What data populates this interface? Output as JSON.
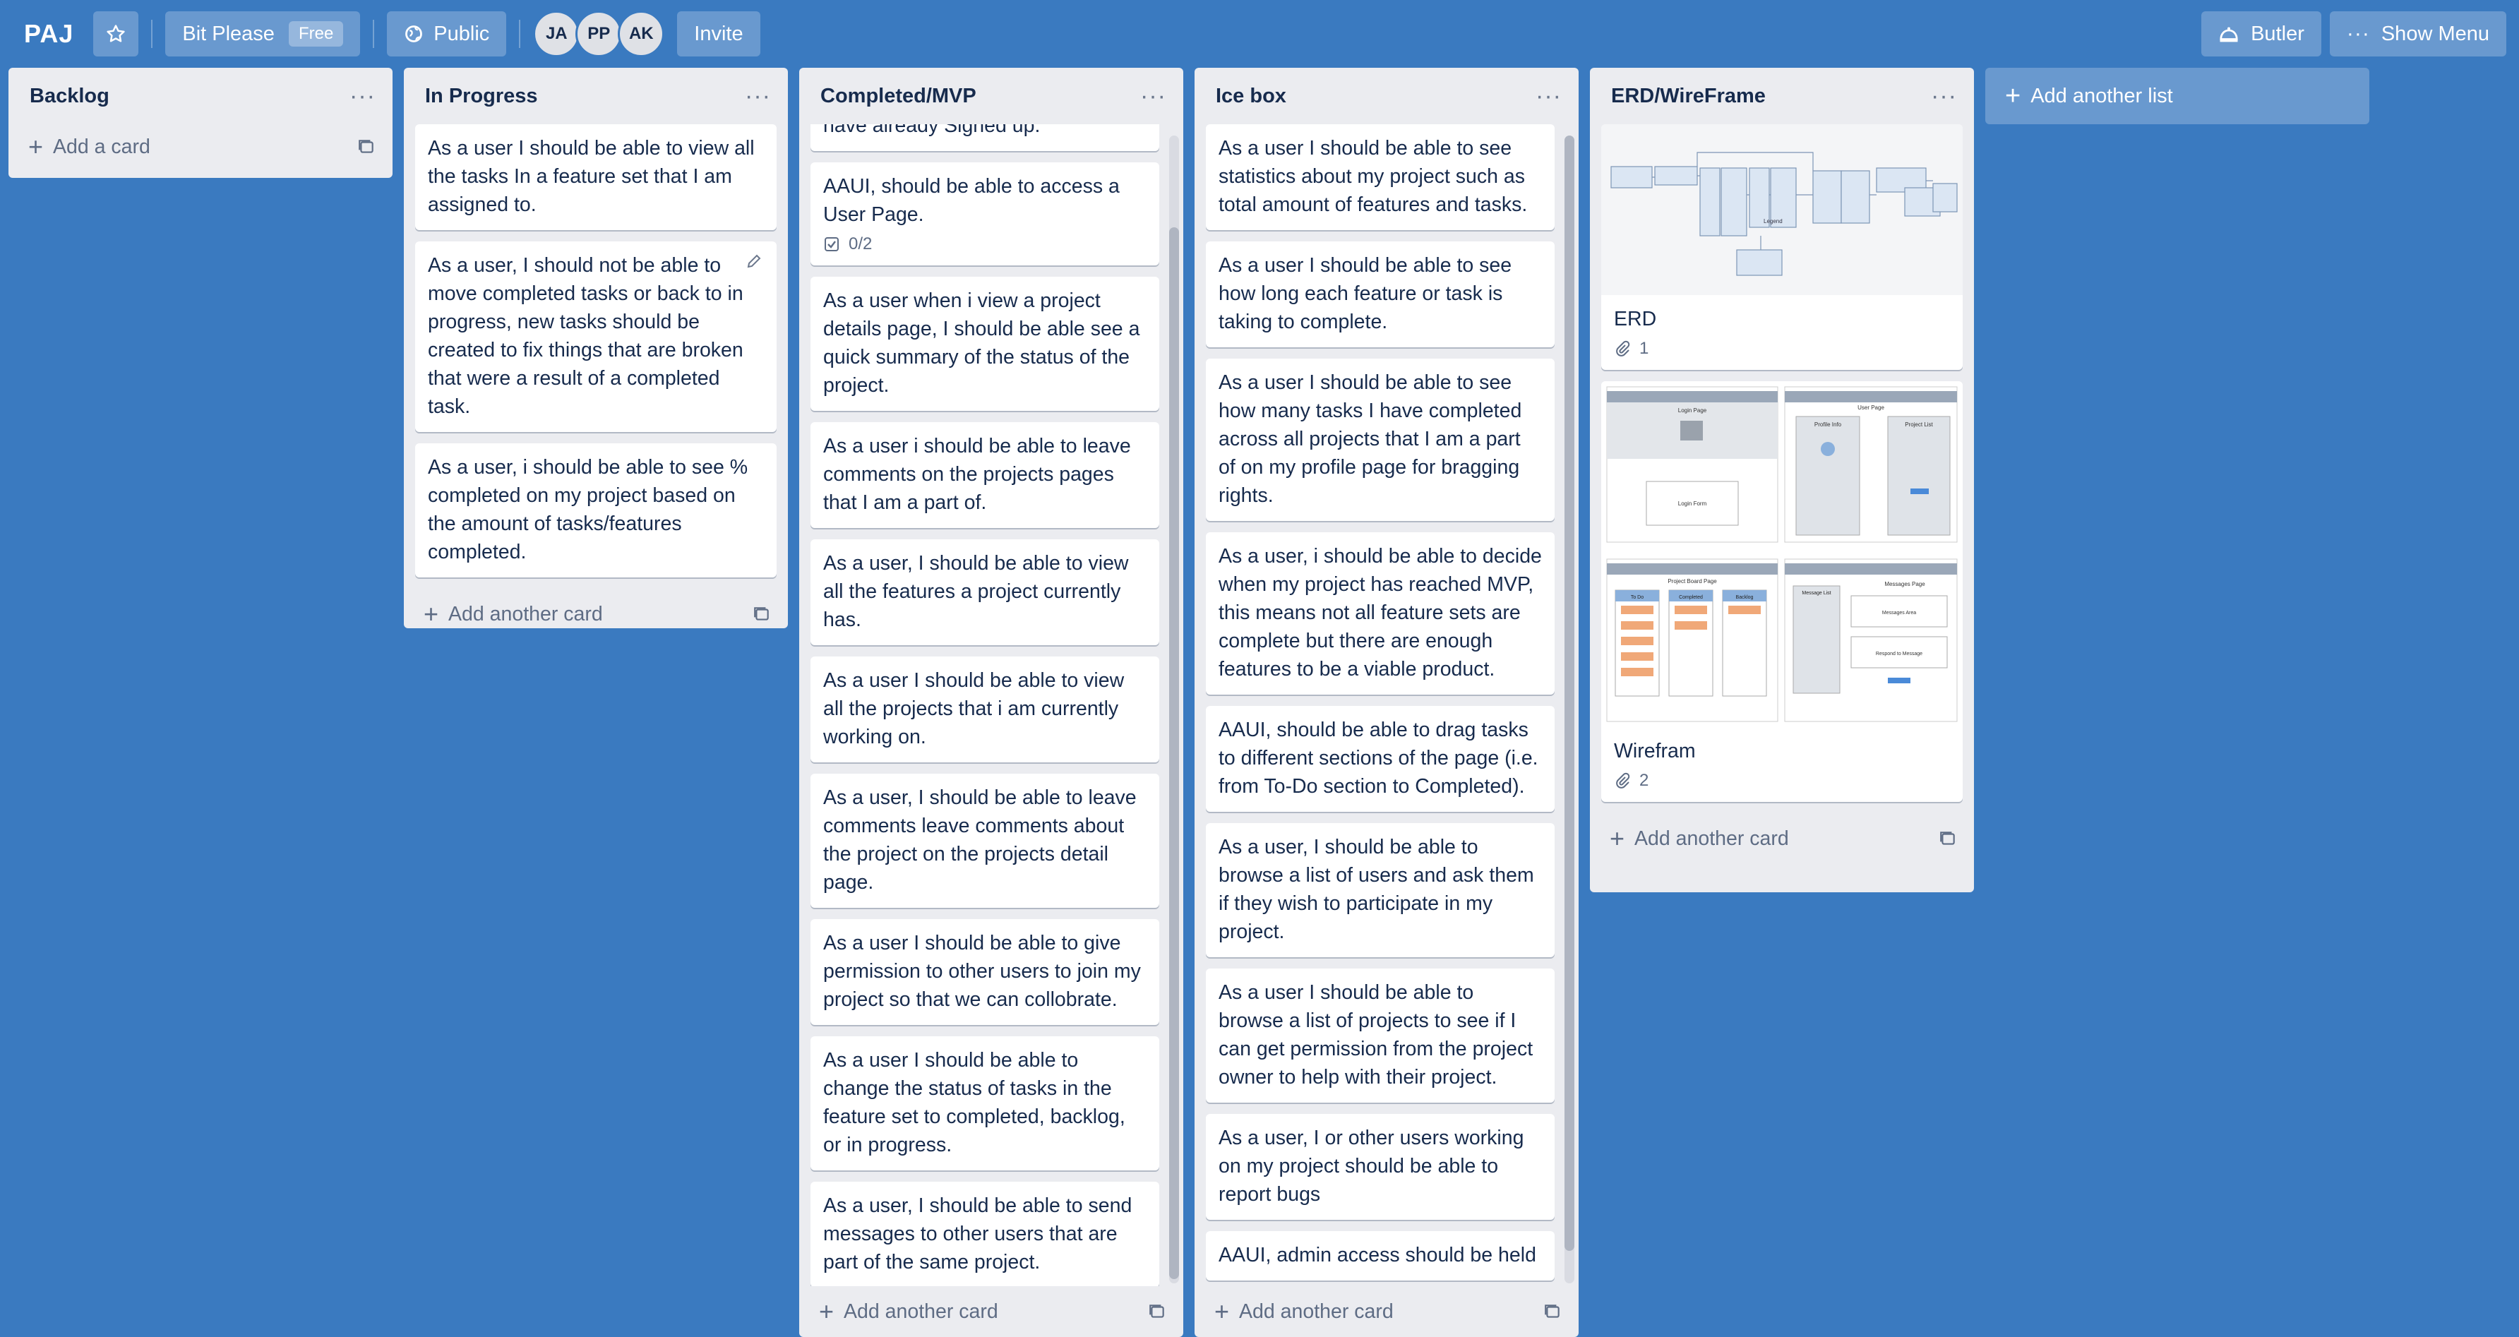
{
  "header": {
    "board_name": "PAJ",
    "team_name": "Bit Please",
    "team_plan": "Free",
    "visibility": "Public",
    "members": [
      "JA",
      "PP",
      "AK"
    ],
    "invite_label": "Invite",
    "butler_label": "Butler",
    "menu_label": "Show Menu"
  },
  "lists": [
    {
      "title": "Backlog",
      "add_label": "Add a card",
      "cards": []
    },
    {
      "title": "In Progress",
      "add_label": "Add another card",
      "cards": [
        "As a user I should be able to view all the tasks In a feature set that I am assigned to.",
        "As a user, I should not be able to move completed tasks or back to in progress, new tasks should be created to fix things that are broken that were a result of a completed task.",
        "As a user, i should be able to see % completed on my project based on the amount of tasks/features completed."
      ]
    },
    {
      "title": "Completed/MVP",
      "add_label": "Add another card",
      "partial_top": "have already Signed up.",
      "cards": [
        "AAUI, should be able to access a User Page.",
        "As a user when i view a project details page, I should be able see a quick summary of the status of the project.",
        "As a user i should be able to leave comments on the projects pages that I am a part of.",
        "As a user, I should be able to view all the features a project currently has.",
        "As a user I should be able to view all the projects that i am currently working on.",
        "As a user, I should be able to leave comments leave comments about the project on the projects detail page.",
        "As a user I should be able to give permission to other users to join my project so that we can collobrate.",
        "As a user I should be able to change the status of tasks in the feature set to completed, backlog, or in progress.",
        "As a user, I should be able to send messages to other users that are part of the same project."
      ],
      "checklist": "0/2"
    },
    {
      "title": "Ice box",
      "add_label": "Add another card",
      "cards": [
        "As a user I should be able to see statistics about my project such as total amount of features and tasks.",
        "As a user I should be able to see how long each feature or task is taking to complete.",
        "As a user I should be able to see how many tasks I have completed across all projects that I am a part of on my profile page for bragging rights.",
        "As a user, i should be able to decide when my project has reached MVP, this means not all feature sets are complete but there are enough features to be a viable product.",
        "AAUI, should be able to drag tasks to different sections of the page (i.e. from To-Do section to Completed).",
        "As a user, I should be able to browse a list of users and ask them if they wish to participate in my project.",
        "As a user I should be able to browse a list of projects to see if I can get permission from the project owner to help with their project.",
        "As a user, I or other users working on my project should be able to report bugs",
        "AAUI, admin access should be held"
      ]
    },
    {
      "title": "ERD/WireFrame",
      "add_label": "Add another card",
      "cards": [
        {
          "title": "ERD",
          "attachments": "1"
        },
        {
          "title": "Wirefram",
          "attachments": "2"
        }
      ]
    }
  ],
  "add_list_label": "Add another list",
  "wireframe_labels": {
    "login_page": "Login Page",
    "login_form": "Login Form",
    "user_page": "User Page",
    "profile_info": "Profile Info",
    "project_list": "Project List",
    "project_board_page": "Project Board Page",
    "to_do": "To Do",
    "completed": "Completed",
    "backlog": "Backlog",
    "messages_page": "Messages Page",
    "message_list": "Message List",
    "message_area": "Messages Area",
    "respond": "Respond to Message",
    "legend": "Legend"
  },
  "colors": {
    "board_bg": "#3a7ac0",
    "list_bg": "#ebecf0",
    "card_bg": "#ffffff"
  }
}
